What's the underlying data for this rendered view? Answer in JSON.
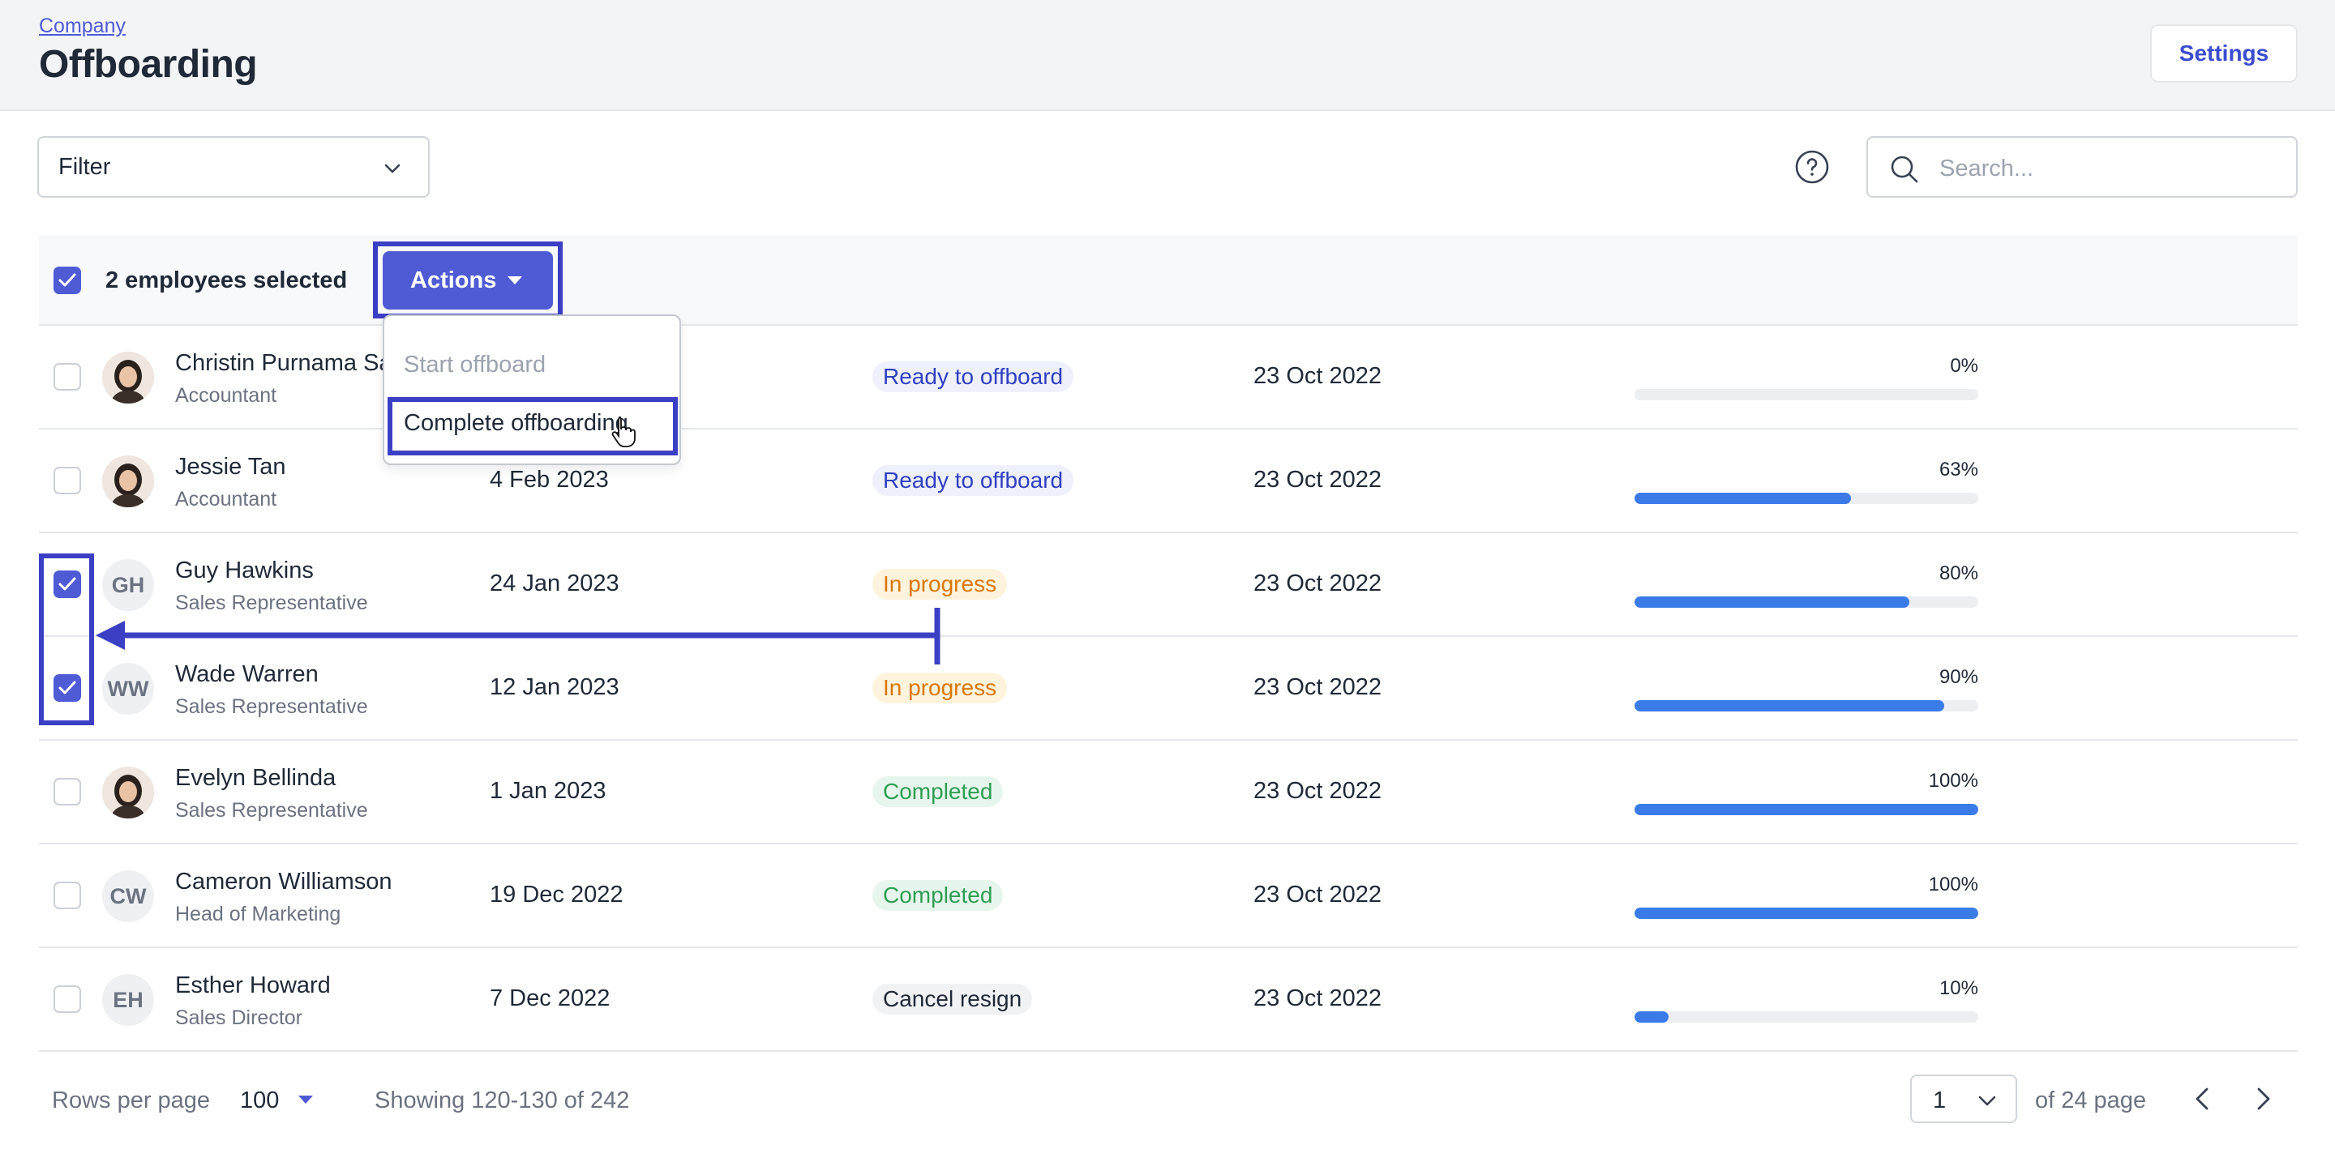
{
  "header": {
    "breadcrumb": "Company",
    "title": "Offboarding",
    "settings_label": "Settings"
  },
  "toolbar": {
    "filter_label": "Filter",
    "search_placeholder": "Search...",
    "help_icon": "help-circle-icon"
  },
  "selection": {
    "text": "2 employees selected",
    "actions_label": "Actions"
  },
  "dropdown": {
    "items": [
      "Start offboard",
      "Complete offboarding"
    ]
  },
  "rows": [
    {
      "name": "Christin Purnama Sa",
      "role": "Accountant",
      "last_day": "",
      "status": "Ready to offboard",
      "request_date": "23 Oct 2022",
      "progress": 0,
      "progress_label": "0%",
      "initials": "",
      "checked": false
    },
    {
      "name": "Jessie Tan",
      "role": "Accountant",
      "last_day": "4 Feb 2023",
      "status": "Ready to offboard",
      "request_date": "23 Oct 2022",
      "progress": 63,
      "progress_label": "63%",
      "initials": "",
      "checked": false
    },
    {
      "name": "Guy Hawkins",
      "role": "Sales Representative",
      "last_day": "24 Jan 2023",
      "status": "In progress",
      "request_date": "23 Oct 2022",
      "progress": 80,
      "progress_label": "80%",
      "initials": "GH",
      "checked": true
    },
    {
      "name": "Wade Warren",
      "role": "Sales Representative",
      "last_day": "12 Jan 2023",
      "status": "In progress",
      "request_date": "23 Oct 2022",
      "progress": 90,
      "progress_label": "90%",
      "initials": "WW",
      "checked": true
    },
    {
      "name": "Evelyn Bellinda",
      "role": "Sales Representative",
      "last_day": "1 Jan 2023",
      "status": "Completed",
      "request_date": "23 Oct 2022",
      "progress": 100,
      "progress_label": "100%",
      "initials": "",
      "checked": false
    },
    {
      "name": "Cameron Williamson",
      "role": "Head of Marketing",
      "last_day": "19 Dec 2022",
      "status": "Completed",
      "request_date": "23 Oct 2022",
      "progress": 100,
      "progress_label": "100%",
      "initials": "CW",
      "checked": false
    },
    {
      "name": "Esther Howard",
      "role": "Sales Director",
      "last_day": "7 Dec 2022",
      "status": "Cancel resign",
      "request_date": "23 Oct 2022",
      "progress": 10,
      "progress_label": "10%",
      "initials": "EH",
      "checked": false
    }
  ],
  "footer": {
    "rows_per_page_label": "Rows per page",
    "rows_per_page_value": "100",
    "showing": "Showing 120-130 of 242",
    "page_value": "1",
    "of_pages": "of 24 page"
  },
  "colors": {
    "accent": "#4f5bd5",
    "annotation": "#3b3fc4",
    "progress": "#3b7be8"
  }
}
